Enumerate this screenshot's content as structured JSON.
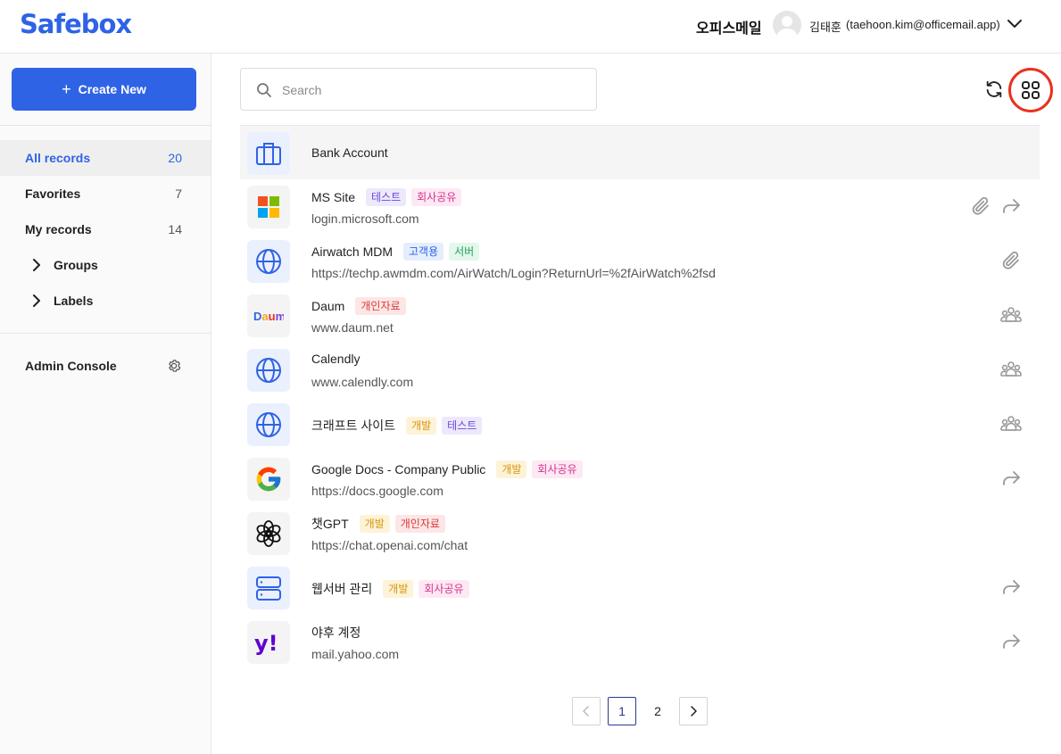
{
  "header": {
    "logo": "Safebox",
    "org_name": "오피스메일",
    "user_name": "김태훈",
    "user_email": "(taehoon.kim@officemail.app)"
  },
  "sidebar": {
    "create_label": "Create New",
    "items": [
      {
        "label": "All records",
        "count": "20"
      },
      {
        "label": "Favorites",
        "count": "7"
      },
      {
        "label": "My records",
        "count": "14"
      }
    ],
    "groups_label": "Groups",
    "labels_label": "Labels",
    "admin_label": "Admin Console"
  },
  "search": {
    "placeholder": "Search"
  },
  "records": [
    {
      "title": "Bank Account",
      "subtitle": "",
      "icon": "briefcase-icon",
      "tags": []
    },
    {
      "title": "MS Site",
      "subtitle": "login.microsoft.com",
      "icon": "microsoft-logo",
      "tags": [
        {
          "label": "테스트",
          "color": "purple"
        },
        {
          "label": "회사공유",
          "color": "pink"
        }
      ],
      "actions": [
        "attachment-icon",
        "share-icon"
      ]
    },
    {
      "title": "Airwatch MDM",
      "subtitle": "https://techp.awmdm.com/AirWatch/Login?ReturnUrl=%2fAirWatch%2fsd",
      "icon": "globe-icon",
      "tags": [
        {
          "label": "고객용",
          "color": "blue"
        },
        {
          "label": "서버",
          "color": "green"
        }
      ],
      "actions": [
        "attachment-icon"
      ]
    },
    {
      "title": "Daum",
      "subtitle": "www.daum.net",
      "icon": "daum-logo",
      "tags": [
        {
          "label": "개인자료",
          "color": "red"
        }
      ],
      "actions": [
        "shared-group-icon"
      ]
    },
    {
      "title": "Calendly",
      "subtitle": "www.calendly.com",
      "icon": "globe-icon",
      "tags": [],
      "actions": [
        "shared-group-icon"
      ]
    },
    {
      "title": "크래프트 사이트",
      "subtitle": "",
      "icon": "globe-icon",
      "tags": [
        {
          "label": "개발",
          "color": "yellow"
        },
        {
          "label": "테스트",
          "color": "purple"
        }
      ],
      "actions": [
        "shared-group-icon"
      ]
    },
    {
      "title": "Google Docs - Company Public",
      "subtitle": "https://docs.google.com",
      "icon": "google-logo",
      "tags": [
        {
          "label": "개발",
          "color": "yellow"
        },
        {
          "label": "회사공유",
          "color": "pink"
        }
      ],
      "actions": [
        "share-icon"
      ]
    },
    {
      "title": "챗GPT",
      "subtitle": "https://chat.openai.com/chat",
      "icon": "openai-logo",
      "tags": [
        {
          "label": "개발",
          "color": "yellow"
        },
        {
          "label": "개인자료",
          "color": "red"
        }
      ],
      "actions": []
    },
    {
      "title": "웹서버 관리",
      "subtitle": "",
      "icon": "server-icon",
      "tags": [
        {
          "label": "개발",
          "color": "yellow"
        },
        {
          "label": "회사공유",
          "color": "pink"
        }
      ],
      "actions": [
        "share-icon"
      ]
    },
    {
      "title": "야후 계정",
      "subtitle": "mail.yahoo.com",
      "icon": "yahoo-logo",
      "tags": [],
      "actions": [
        "share-icon"
      ]
    }
  ],
  "pagination": {
    "pages": [
      "1",
      "2"
    ],
    "current": "1"
  },
  "colors": {
    "accent": "#2f63e6",
    "highlight_ring": "#e8311f"
  }
}
